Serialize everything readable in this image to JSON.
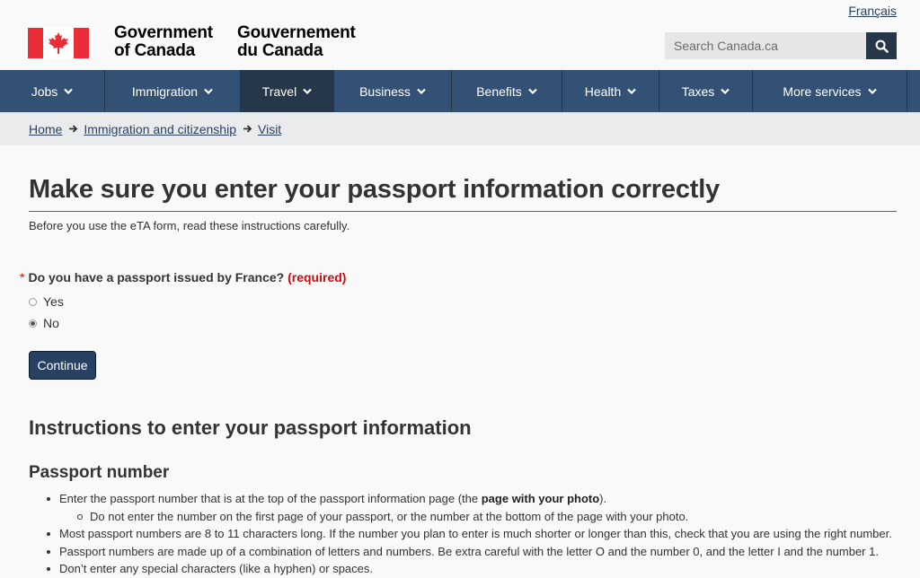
{
  "header": {
    "language_link": "Français",
    "gov_name_en": [
      "Government",
      "of Canada"
    ],
    "gov_name_fr": [
      "Gouvernement",
      "du Canada"
    ],
    "search_placeholder": "Search Canada.ca"
  },
  "nav": {
    "items": [
      {
        "label": "Jobs",
        "active": false
      },
      {
        "label": "Immigration",
        "active": false
      },
      {
        "label": "Travel",
        "active": true
      },
      {
        "label": "Business",
        "active": false
      },
      {
        "label": "Benefits",
        "active": false
      },
      {
        "label": "Health",
        "active": false
      },
      {
        "label": "Taxes",
        "active": false
      },
      {
        "label": "More services",
        "active": false
      }
    ]
  },
  "breadcrumb": [
    "Home",
    "Immigration and citizenship",
    "Visit"
  ],
  "main": {
    "title": "Make sure you enter your passport information correctly",
    "intro": "Before you use the eTA form, read these instructions carefully.",
    "question": {
      "text": "Do you have a passport issued by France?",
      "required_label": "(required)",
      "options": [
        {
          "label": "Yes",
          "checked": false
        },
        {
          "label": "No",
          "checked": true
        }
      ]
    },
    "continue_label": "Continue",
    "instructions_heading": "Instructions to enter your passport information",
    "passport_number_heading": "Passport number",
    "bullets": {
      "b1_pre": "Enter the passport number that is at the top of the passport information page (the ",
      "b1_bold": "page with your photo",
      "b1_post": ").",
      "b1_sub": "Do not enter the number on the first page of your passport, or the number at the bottom of the page with your photo.",
      "b2": "Most passport numbers are 8 to 11 characters long. If the number you plan to enter is much shorter or longer than this, check that you are using the right number.",
      "b3": "Passport numbers are made up of a combination of letters and numbers. Be extra careful with the letter O and the number 0, and the letter I and the number 1.",
      "b4": "Don’t enter any special characters (like a hyphen) or spaces."
    }
  },
  "colors": {
    "nav_bg": "#335075",
    "nav_active": "#26374a",
    "flag_red": "#eb2d37",
    "required_red": "#d3080c",
    "button_bg": "#284162",
    "title_rule": "#af3c43"
  },
  "icons": {
    "search": "search-icon",
    "nav_chevron": "chevron-down-icon",
    "breadcrumb_arrow": "arrow-right-icon",
    "flag": "canada-flag-icon"
  }
}
